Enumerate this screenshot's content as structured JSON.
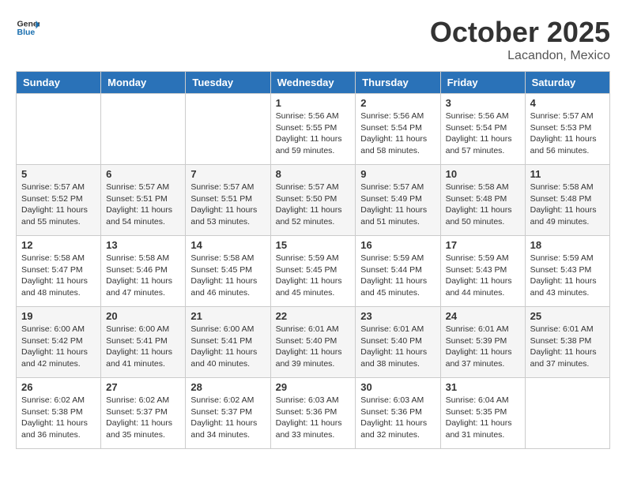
{
  "header": {
    "logo_general": "General",
    "logo_blue": "Blue",
    "month_title": "October 2025",
    "location": "Lacandon, Mexico"
  },
  "weekdays": [
    "Sunday",
    "Monday",
    "Tuesday",
    "Wednesday",
    "Thursday",
    "Friday",
    "Saturday"
  ],
  "weeks": [
    [
      {
        "day": "",
        "info": ""
      },
      {
        "day": "",
        "info": ""
      },
      {
        "day": "",
        "info": ""
      },
      {
        "day": "1",
        "info": "Sunrise: 5:56 AM\nSunset: 5:55 PM\nDaylight: 11 hours\nand 59 minutes."
      },
      {
        "day": "2",
        "info": "Sunrise: 5:56 AM\nSunset: 5:54 PM\nDaylight: 11 hours\nand 58 minutes."
      },
      {
        "day": "3",
        "info": "Sunrise: 5:56 AM\nSunset: 5:54 PM\nDaylight: 11 hours\nand 57 minutes."
      },
      {
        "day": "4",
        "info": "Sunrise: 5:57 AM\nSunset: 5:53 PM\nDaylight: 11 hours\nand 56 minutes."
      }
    ],
    [
      {
        "day": "5",
        "info": "Sunrise: 5:57 AM\nSunset: 5:52 PM\nDaylight: 11 hours\nand 55 minutes."
      },
      {
        "day": "6",
        "info": "Sunrise: 5:57 AM\nSunset: 5:51 PM\nDaylight: 11 hours\nand 54 minutes."
      },
      {
        "day": "7",
        "info": "Sunrise: 5:57 AM\nSunset: 5:51 PM\nDaylight: 11 hours\nand 53 minutes."
      },
      {
        "day": "8",
        "info": "Sunrise: 5:57 AM\nSunset: 5:50 PM\nDaylight: 11 hours\nand 52 minutes."
      },
      {
        "day": "9",
        "info": "Sunrise: 5:57 AM\nSunset: 5:49 PM\nDaylight: 11 hours\nand 51 minutes."
      },
      {
        "day": "10",
        "info": "Sunrise: 5:58 AM\nSunset: 5:48 PM\nDaylight: 11 hours\nand 50 minutes."
      },
      {
        "day": "11",
        "info": "Sunrise: 5:58 AM\nSunset: 5:48 PM\nDaylight: 11 hours\nand 49 minutes."
      }
    ],
    [
      {
        "day": "12",
        "info": "Sunrise: 5:58 AM\nSunset: 5:47 PM\nDaylight: 11 hours\nand 48 minutes."
      },
      {
        "day": "13",
        "info": "Sunrise: 5:58 AM\nSunset: 5:46 PM\nDaylight: 11 hours\nand 47 minutes."
      },
      {
        "day": "14",
        "info": "Sunrise: 5:58 AM\nSunset: 5:45 PM\nDaylight: 11 hours\nand 46 minutes."
      },
      {
        "day": "15",
        "info": "Sunrise: 5:59 AM\nSunset: 5:45 PM\nDaylight: 11 hours\nand 45 minutes."
      },
      {
        "day": "16",
        "info": "Sunrise: 5:59 AM\nSunset: 5:44 PM\nDaylight: 11 hours\nand 45 minutes."
      },
      {
        "day": "17",
        "info": "Sunrise: 5:59 AM\nSunset: 5:43 PM\nDaylight: 11 hours\nand 44 minutes."
      },
      {
        "day": "18",
        "info": "Sunrise: 5:59 AM\nSunset: 5:43 PM\nDaylight: 11 hours\nand 43 minutes."
      }
    ],
    [
      {
        "day": "19",
        "info": "Sunrise: 6:00 AM\nSunset: 5:42 PM\nDaylight: 11 hours\nand 42 minutes."
      },
      {
        "day": "20",
        "info": "Sunrise: 6:00 AM\nSunset: 5:41 PM\nDaylight: 11 hours\nand 41 minutes."
      },
      {
        "day": "21",
        "info": "Sunrise: 6:00 AM\nSunset: 5:41 PM\nDaylight: 11 hours\nand 40 minutes."
      },
      {
        "day": "22",
        "info": "Sunrise: 6:01 AM\nSunset: 5:40 PM\nDaylight: 11 hours\nand 39 minutes."
      },
      {
        "day": "23",
        "info": "Sunrise: 6:01 AM\nSunset: 5:40 PM\nDaylight: 11 hours\nand 38 minutes."
      },
      {
        "day": "24",
        "info": "Sunrise: 6:01 AM\nSunset: 5:39 PM\nDaylight: 11 hours\nand 37 minutes."
      },
      {
        "day": "25",
        "info": "Sunrise: 6:01 AM\nSunset: 5:38 PM\nDaylight: 11 hours\nand 37 minutes."
      }
    ],
    [
      {
        "day": "26",
        "info": "Sunrise: 6:02 AM\nSunset: 5:38 PM\nDaylight: 11 hours\nand 36 minutes."
      },
      {
        "day": "27",
        "info": "Sunrise: 6:02 AM\nSunset: 5:37 PM\nDaylight: 11 hours\nand 35 minutes."
      },
      {
        "day": "28",
        "info": "Sunrise: 6:02 AM\nSunset: 5:37 PM\nDaylight: 11 hours\nand 34 minutes."
      },
      {
        "day": "29",
        "info": "Sunrise: 6:03 AM\nSunset: 5:36 PM\nDaylight: 11 hours\nand 33 minutes."
      },
      {
        "day": "30",
        "info": "Sunrise: 6:03 AM\nSunset: 5:36 PM\nDaylight: 11 hours\nand 32 minutes."
      },
      {
        "day": "31",
        "info": "Sunrise: 6:04 AM\nSunset: 5:35 PM\nDaylight: 11 hours\nand 31 minutes."
      },
      {
        "day": "",
        "info": ""
      }
    ]
  ]
}
